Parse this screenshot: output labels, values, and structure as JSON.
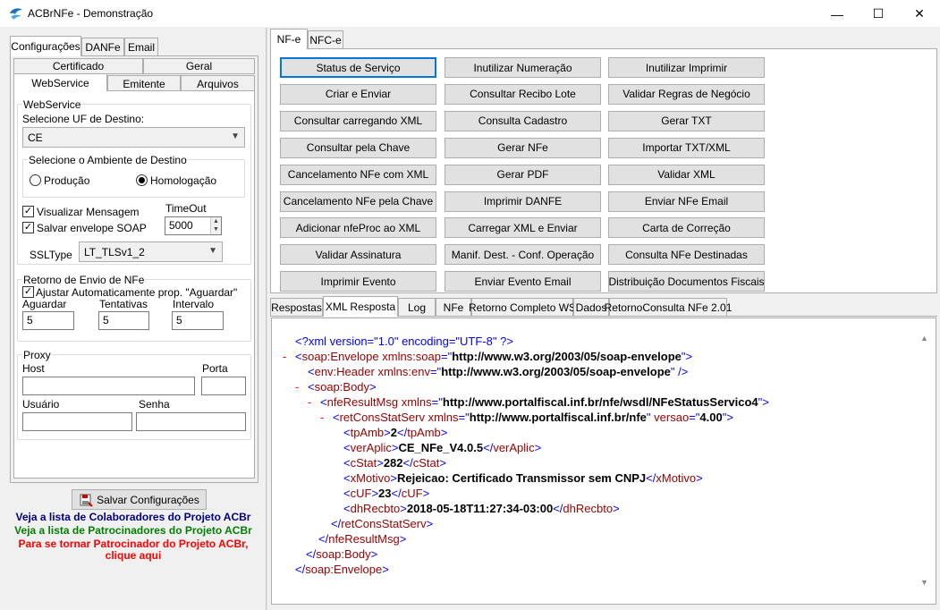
{
  "window": {
    "title": "ACBrNFe - Demonstração",
    "minimize_glyph": "—",
    "maximize_glyph": "☐",
    "close_glyph": "✕"
  },
  "left": {
    "tabs": [
      "Configurações",
      "DANFe",
      "Email"
    ],
    "subtabs_row1": [
      "Certificado",
      "Geral"
    ],
    "subtabs_row2": [
      "WebService",
      "Emitente",
      "Arquivos"
    ],
    "webservice": {
      "group_title": "WebService",
      "uf_label": "Selecione UF de Destino:",
      "uf_value": "CE",
      "ambiente_title": "Selecione o Ambiente de Destino",
      "producao_label": "Produção",
      "homologacao_label": "Homologação",
      "homologacao_selected": true,
      "visualizar_label": "Visualizar Mensagem",
      "visualizar_checked": true,
      "salvar_label": "Salvar envelope SOAP",
      "salvar_checked": true,
      "timeout_label": "TimeOut",
      "timeout_value": "5000",
      "ssltype_label": "SSLType",
      "ssltype_value": "LT_TLSv1_2"
    },
    "retorno": {
      "group_title": "Retorno de Envio de NFe",
      "ajustar_label": "Ajustar Automaticamente prop. \"Aguardar\"",
      "ajustar_checked": true,
      "aguardar_label": "Aguardar",
      "aguardar_value": "5",
      "tentativas_label": "Tentativas",
      "tentativas_value": "5",
      "intervalo_label": "Intervalo",
      "intervalo_value": "5"
    },
    "proxy": {
      "group_title": "Proxy",
      "host_label": "Host",
      "porta_label": "Porta",
      "usuario_label": "Usuário",
      "senha_label": "Senha"
    },
    "save_button": "Salvar Configurações",
    "links": {
      "colaboradores": "Veja a lista de Colaboradores do Projeto ACBr",
      "patrocinadores": "Veja a lista de Patrocinadores do Projeto ACBr",
      "patrocinador1": "Para se tornar Patrocinador do Projeto ACBr,",
      "patrocinador2": "clique aqui",
      "color_blue": "#000080",
      "color_green": "#008000",
      "color_red": "#ff0000"
    }
  },
  "right": {
    "top_tabs": [
      "NF-e",
      "NFC-e"
    ],
    "buttons": [
      [
        "Status de Serviço",
        "Inutilizar Numeração",
        "Inutilizar Imprimir"
      ],
      [
        "Criar e Enviar",
        "Consultar Recibo Lote",
        "Validar Regras de Negócio"
      ],
      [
        "Consultar carregando XML",
        "Consulta Cadastro",
        "Gerar TXT"
      ],
      [
        "Consultar pela Chave",
        "Gerar NFe",
        "Importar TXT/XML"
      ],
      [
        "Cancelamento NFe com XML",
        "Gerar PDF",
        "Validar XML"
      ],
      [
        "Cancelamento NFe pela Chave",
        "Imprimir DANFE",
        "Enviar NFe Email"
      ],
      [
        "Adicionar nfeProc ao XML",
        "Carregar XML e Enviar",
        "Carta de Correção"
      ],
      [
        "Validar Assinatura",
        "Manif. Dest. - Conf. Operação",
        "Consulta NFe Destinadas"
      ],
      [
        "Imprimir Evento",
        "Enviar Evento Email",
        "Distribuição Documentos Fiscais"
      ]
    ],
    "bottom_tabs": [
      "Respostas",
      "XML Resposta",
      "Log",
      "NFe",
      "Retorno Completo WS",
      "Dados",
      "RetornoConsulta NFe 2.01"
    ],
    "xml": {
      "decl": "<?xml version=\"1.0\" encoding=\"UTF-8\" ?>",
      "minus": "-",
      "env_open": "soap:Envelope",
      "env_attr": "xmlns:soap",
      "env_ns": "http://www.w3.org/2003/05/soap-envelope",
      "header": "env:Header",
      "header_attr": "xmlns:env",
      "header_ns": "http://www.w3.org/2003/05/soap-envelope",
      "body": "soap:Body",
      "result": "nfeResultMsg",
      "result_attr": "xmlns",
      "result_ns": "http://www.portalfiscal.inf.br/nfe/wsdl/NFeStatusServico4",
      "ret": "retConsStatServ",
      "ret_attr": "xmlns",
      "ret_ns": "http://www.portalfiscal.inf.br/nfe",
      "ret_versao_attr": "versao",
      "ret_versao": "4.00",
      "fields": [
        {
          "tag": "tpAmb",
          "value": "2"
        },
        {
          "tag": "verAplic",
          "value": "CE_NFe_V4.0.5"
        },
        {
          "tag": "cStat",
          "value": "282"
        },
        {
          "tag": "xMotivo",
          "value": "Rejeicao: Certificado Transmissor sem CNPJ"
        },
        {
          "tag": "cUF",
          "value": "23"
        },
        {
          "tag": "dhRecbto",
          "value": "2018-05-18T11:27:34-03:00"
        }
      ]
    }
  }
}
